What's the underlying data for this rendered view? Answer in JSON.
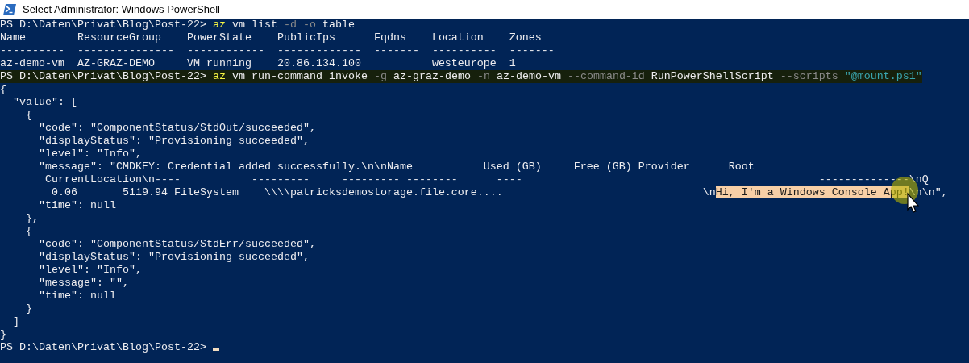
{
  "window": {
    "title": "Select Administrator: Windows PowerShell"
  },
  "lines": [
    {
      "segments": [
        {
          "kind": "prompt",
          "text": "PS D:\\Daten\\Privat\\Blog\\Post-22> "
        },
        {
          "kind": "command",
          "text": "az"
        },
        {
          "kind": "plain",
          "text": " vm list "
        },
        {
          "kind": "parameter",
          "text": "-d"
        },
        {
          "kind": "parameter",
          "text": " -o"
        },
        {
          "kind": "plain",
          "text": " table"
        }
      ]
    },
    {
      "segments": [
        {
          "kind": "plain",
          "text": "Name        ResourceGroup    PowerState    PublicIps      Fqdns    Location    Zones"
        }
      ]
    },
    {
      "segments": [
        {
          "kind": "plain",
          "text": "----------  ---------------  ------------  -------------  -------  ----------  -------"
        }
      ]
    },
    {
      "segments": [
        {
          "kind": "plain",
          "text": "az-demo-vm  AZ-GRAZ-DEMO     VM running    20.86.134.100           westeurope  1"
        }
      ]
    },
    {
      "highlighted": true,
      "segments": [
        {
          "kind": "prompt",
          "text": "PS D:\\Daten\\Privat\\Blog\\Post-22> "
        },
        {
          "kind": "command",
          "text": "az"
        },
        {
          "kind": "plain",
          "text": " vm run-command invoke "
        },
        {
          "kind": "parameter",
          "text": "-g"
        },
        {
          "kind": "plain",
          "text": " az-graz-demo "
        },
        {
          "kind": "parameter",
          "text": "-n"
        },
        {
          "kind": "plain",
          "text": " az-demo-vm "
        },
        {
          "kind": "parameter",
          "text": "--command-id"
        },
        {
          "kind": "plain",
          "text": " RunPowerShellScript "
        },
        {
          "kind": "parameter",
          "text": "--scripts"
        },
        {
          "kind": "string",
          "text": " \"@mount.ps1\""
        }
      ]
    },
    {
      "segments": [
        {
          "kind": "plain",
          "text": "{"
        }
      ]
    },
    {
      "segments": [
        {
          "kind": "plain",
          "text": "  \"value\": ["
        }
      ]
    },
    {
      "segments": [
        {
          "kind": "plain",
          "text": "    {"
        }
      ]
    },
    {
      "segments": [
        {
          "kind": "plain",
          "text": "      \"code\": \"ComponentStatus/StdOut/succeeded\","
        }
      ]
    },
    {
      "segments": [
        {
          "kind": "plain",
          "text": "      \"displayStatus\": \"Provisioning succeeded\","
        }
      ]
    },
    {
      "segments": [
        {
          "kind": "plain",
          "text": "      \"level\": \"Info\","
        }
      ]
    },
    {
      "segments": [
        {
          "kind": "plain",
          "text": "      \"message\": \"CMDKEY: Credential added successfully.\\n\\nName           Used (GB)     Free (GB) Provider      Root"
        }
      ]
    },
    {
      "segments": [
        {
          "kind": "plain",
          "text": "       CurrentLocation\\n----           ---------     --------- --------      ----                                              --------------\\nQ"
        }
      ]
    },
    {
      "segments": [
        {
          "kind": "plain",
          "text": "        0.06       5119.94 FileSystem    \\\\\\\\patricksdemostorage.file.core....                               \\n"
        },
        {
          "kind": "selected",
          "text": "Hi, I'm a Windows Console App!"
        },
        {
          "kind": "plain",
          "text": "\\n\\n\","
        }
      ]
    },
    {
      "segments": [
        {
          "kind": "plain",
          "text": "      \"time\": null"
        }
      ]
    },
    {
      "segments": [
        {
          "kind": "plain",
          "text": "    },"
        }
      ]
    },
    {
      "segments": [
        {
          "kind": "plain",
          "text": "    {"
        }
      ]
    },
    {
      "segments": [
        {
          "kind": "plain",
          "text": "      \"code\": \"ComponentStatus/StdErr/succeeded\","
        }
      ]
    },
    {
      "segments": [
        {
          "kind": "plain",
          "text": "      \"displayStatus\": \"Provisioning succeeded\","
        }
      ]
    },
    {
      "segments": [
        {
          "kind": "plain",
          "text": "      \"level\": \"Info\","
        }
      ]
    },
    {
      "segments": [
        {
          "kind": "plain",
          "text": "      \"message\": \"\","
        }
      ]
    },
    {
      "segments": [
        {
          "kind": "plain",
          "text": "      \"time\": null"
        }
      ]
    },
    {
      "segments": [
        {
          "kind": "plain",
          "text": "    }"
        }
      ]
    },
    {
      "segments": [
        {
          "kind": "plain",
          "text": "  ]"
        }
      ]
    },
    {
      "segments": [
        {
          "kind": "plain",
          "text": "}"
        }
      ]
    },
    {
      "cursor": true,
      "segments": [
        {
          "kind": "prompt",
          "text": "PS D:\\Daten\\Privat\\Blog\\Post-22> "
        }
      ]
    }
  ]
}
